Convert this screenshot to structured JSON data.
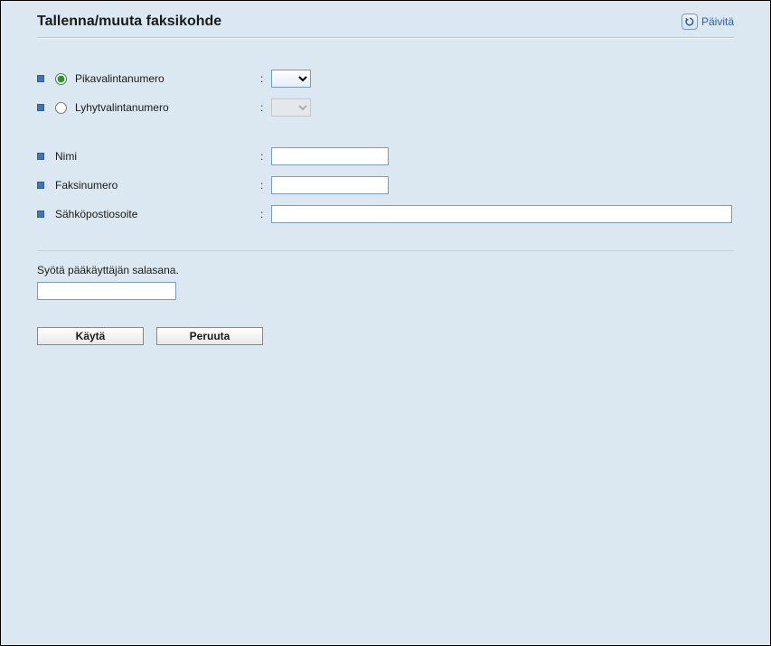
{
  "header": {
    "title": "Tallenna/muuta faksikohde",
    "refresh_label": "Päivitä"
  },
  "form": {
    "quick_dial_label": "Pikavalintanumero",
    "short_dial_label": "Lyhytvalintanumero",
    "name_label": "Nimi",
    "fax_label": "Faksinumero",
    "email_label": "Sähköpostiosoite",
    "quick_dial_value": "",
    "short_dial_value": "",
    "name_value": "",
    "fax_value": "",
    "email_value": ""
  },
  "password": {
    "label": "Syötä pääkäyttäjän salasana.",
    "value": ""
  },
  "buttons": {
    "apply": "Käytä",
    "cancel": "Peruuta"
  }
}
